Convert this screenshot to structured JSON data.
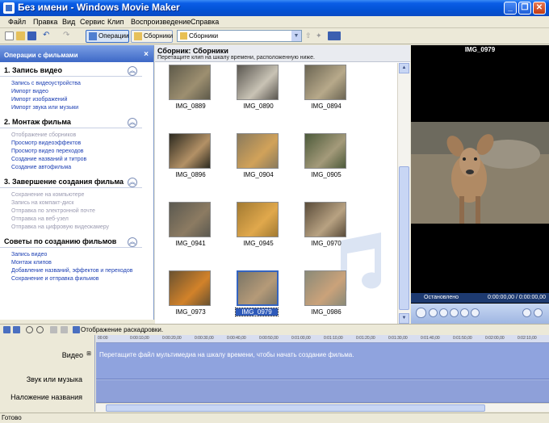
{
  "window": {
    "title": "Без имени - Windows Movie Maker"
  },
  "menu": [
    "Файл",
    "Правка",
    "Вид",
    "Сервис",
    "Клип",
    "Воспроизведение",
    "Справка"
  ],
  "toolbar": {
    "operations_label": "Операции",
    "collections_label": "Сборники",
    "combo_value": "Сборники"
  },
  "tasks": {
    "header": "Операции с фильмами",
    "sections": [
      {
        "title": "1. Запись видео",
        "items": [
          {
            "label": "Запись с видеоустройства",
            "enabled": true
          },
          {
            "label": "Импорт видео",
            "enabled": true
          },
          {
            "label": "Импорт изображений",
            "enabled": true
          },
          {
            "label": "Импорт звука или музыки",
            "enabled": true
          }
        ]
      },
      {
        "title": "2. Монтаж фильма",
        "items": [
          {
            "label": "Отображение сборников",
            "enabled": false
          },
          {
            "label": "Просмотр видеоэффектов",
            "enabled": true
          },
          {
            "label": "Просмотр видео переходов",
            "enabled": true
          },
          {
            "label": "Создание названий и титров",
            "enabled": true
          },
          {
            "label": "Создание автофильма",
            "enabled": true
          }
        ]
      },
      {
        "title": "3. Завершение создания фильма",
        "items": [
          {
            "label": "Сохранение на компьютере",
            "enabled": false
          },
          {
            "label": "Запись на компакт-диск",
            "enabled": false
          },
          {
            "label": "Отправка по электронной почте",
            "enabled": false
          },
          {
            "label": "Отправка на веб-узел",
            "enabled": false
          },
          {
            "label": "Отправка на цифровую видеокамеру",
            "enabled": false
          }
        ]
      },
      {
        "title": "Советы по созданию фильмов",
        "items": [
          {
            "label": "Запись видео",
            "enabled": true
          },
          {
            "label": "Монтаж клипов",
            "enabled": true
          },
          {
            "label": "Добавление названий, эффектов и переходов",
            "enabled": true
          },
          {
            "label": "Сохранение и отправка фильмов",
            "enabled": true
          }
        ]
      }
    ]
  },
  "collection": {
    "title": "Сборник: Сборники",
    "subtitle": "Перетащите клип на шкалу времени, расположенную ниже.",
    "clips": [
      "IMG_0889",
      "IMG_0890",
      "IMG_0894",
      "IMG_0896",
      "IMG_0904",
      "IMG_0905",
      "IMG_0941",
      "IMG_0945",
      "IMG_0970",
      "IMG_0973",
      "IMG_0979",
      "IMG_0986"
    ],
    "selected": "IMG_0979"
  },
  "player": {
    "title": "IMG_0979",
    "status": "Остановлено",
    "time": "0:00:00,00 / 0:00:00,00"
  },
  "timeline": {
    "toolbar_label": "Отображение раскадровки.",
    "ruler": [
      "00:00",
      "0:00:10,00",
      "0:00:20,00",
      "0:00:30,00",
      "0:00:40,00",
      "0:00:50,00",
      "0:01:00,00",
      "0:01:10,00",
      "0:01:20,00",
      "0:01:30,00",
      "0:01:40,00",
      "0:01:50,00",
      "0:02:00,00",
      "0:02:10,00"
    ],
    "tracks": {
      "video": "Видео",
      "audio": "Звук или музыка",
      "title": "Наложение названия"
    },
    "hint": "Перетащите файл мультимедиа на шкалу времени, чтобы начать создание фильма."
  },
  "status": "Готово",
  "colors": {
    "titlebar": "#0a5de6",
    "link": "#1c3fb3",
    "selection": "#2e5ab9",
    "timeline": "#8fa3de"
  }
}
